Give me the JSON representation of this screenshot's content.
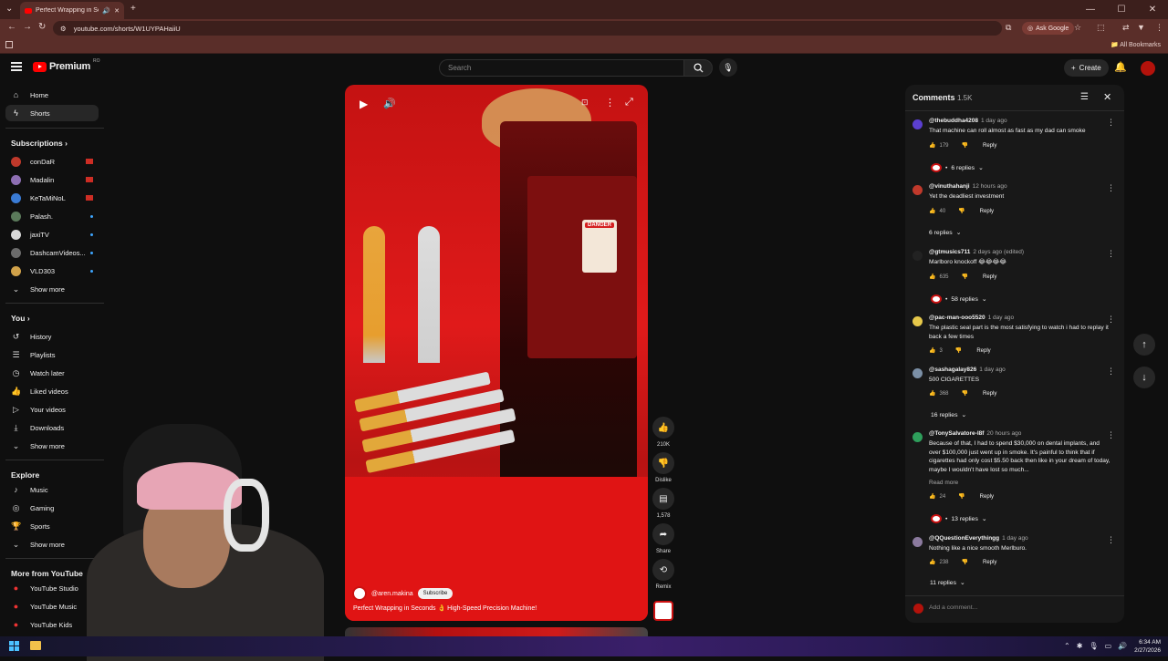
{
  "browser": {
    "tab_title": "Perfect Wrapping in Seconds",
    "url": "youtube.com/shorts/W1UYPAHaiiU",
    "ask_google": "Ask Google",
    "all_bookmarks": "All Bookmarks"
  },
  "header": {
    "brand": "Premium",
    "country": "RO",
    "search_placeholder": "Search",
    "create_label": "Create"
  },
  "sidebar": {
    "main": [
      {
        "label": "Home",
        "icon": "home-icon"
      },
      {
        "label": "Shorts",
        "icon": "shorts-icon"
      }
    ],
    "subscriptions_title": "Subscriptions",
    "subscriptions": [
      {
        "label": "conDaR",
        "color": "#c0392b",
        "live": true
      },
      {
        "label": "Madalin",
        "color": "#8e6fb3",
        "live": true
      },
      {
        "label": "KeTaMiNoL",
        "color": "#3a7bd5",
        "live": true
      },
      {
        "label": "Palash.",
        "color": "#5b7a5b",
        "live": false
      },
      {
        "label": "jaxiTV",
        "color": "#d9d9d9",
        "live": false
      },
      {
        "label": "DashcamVideos...",
        "color": "#6b6b6b",
        "live": false
      },
      {
        "label": "VLD303",
        "color": "#d1a24a",
        "live": false
      }
    ],
    "show_more": "Show more",
    "you_title": "You",
    "you": [
      {
        "label": "History",
        "icon": "history-icon"
      },
      {
        "label": "Playlists",
        "icon": "playlists-icon"
      },
      {
        "label": "Watch later",
        "icon": "watch-later-icon"
      },
      {
        "label": "Liked videos",
        "icon": "liked-icon"
      },
      {
        "label": "Your videos",
        "icon": "your-videos-icon"
      },
      {
        "label": "Downloads",
        "icon": "downloads-icon"
      }
    ],
    "explore_title": "Explore",
    "explore": [
      {
        "label": "Music",
        "icon": "music-icon"
      },
      {
        "label": "Gaming",
        "icon": "gaming-icon"
      },
      {
        "label": "Sports",
        "icon": "sports-icon"
      }
    ],
    "more_title": "More from YouTube",
    "more": [
      {
        "label": "YouTube Studio"
      },
      {
        "label": "YouTube Music"
      },
      {
        "label": "YouTube Kids"
      }
    ]
  },
  "video": {
    "channel": "@aren.makina",
    "subscribe": "Subscribe",
    "title": "Perfect Wrapping in Seconds 👌 High-Speed Precision Machine!",
    "danger": "DANGER",
    "likes": "210K",
    "dislike": "Dislike",
    "comments": "1,578",
    "share": "Share",
    "remix": "Remix"
  },
  "comments": {
    "title": "Comments",
    "count": "1.5K",
    "add_placeholder": "Add a comment...",
    "items": [
      {
        "user": "@thebuddha4208",
        "time": "1 day ago",
        "text": "That machine can roll almost as fast as my dad can smoke",
        "likes": "179",
        "reply": "Reply",
        "replies": "6 replies",
        "creator": true,
        "color": "#5b3fd1"
      },
      {
        "user": "@vinuthahanji",
        "time": "12 hours ago",
        "text": "Yet the deadliest investment",
        "likes": "40",
        "reply": "Reply",
        "replies": "6 replies",
        "creator": false,
        "color": "#c0392b"
      },
      {
        "user": "@gtmusics711",
        "time": "2 days ago (edited)",
        "text": "Marlboro knockoff 😂😂😂😂",
        "likes": "635",
        "reply": "Reply",
        "replies": "58 replies",
        "creator": true,
        "color": "#222222"
      },
      {
        "user": "@pac-man-ooo5520",
        "time": "1 day ago",
        "text": "The plastic seal part is the most satisfying to watch i had to replay it back a few times",
        "likes": "3",
        "reply": "Reply",
        "replies": "",
        "creator": false,
        "color": "#e6c84a"
      },
      {
        "user": "@sashagalay826",
        "time": "1 day ago",
        "text": "500 CIGARETTES",
        "likes": "368",
        "reply": "Reply",
        "replies": "16 replies",
        "creator": false,
        "color": "#7b8fa6"
      },
      {
        "user": "@TonySalvatore-l8f",
        "time": "20 hours ago",
        "text": "Because of that, I had to spend $30,000 on dental implants, and over $100,000 just went up in smoke. It's painful to think that if cigarettes had only cost $5.50 back then like in your dream of today, maybe I wouldn't have lost so much...",
        "read_more": "Read more",
        "likes": "24",
        "reply": "Reply",
        "replies": "13 replies",
        "creator": true,
        "color": "#2e9e5b"
      },
      {
        "user": "@QQuestionEverythingg",
        "time": "1 day ago",
        "text": "Nothing like a nice smooth Merlburo.",
        "likes": "238",
        "reply": "Reply",
        "replies": "11 replies",
        "creator": false,
        "color": "#8b7a9e"
      }
    ]
  },
  "taskbar": {
    "time": "6:34 AM",
    "date": "2/27/2026"
  }
}
